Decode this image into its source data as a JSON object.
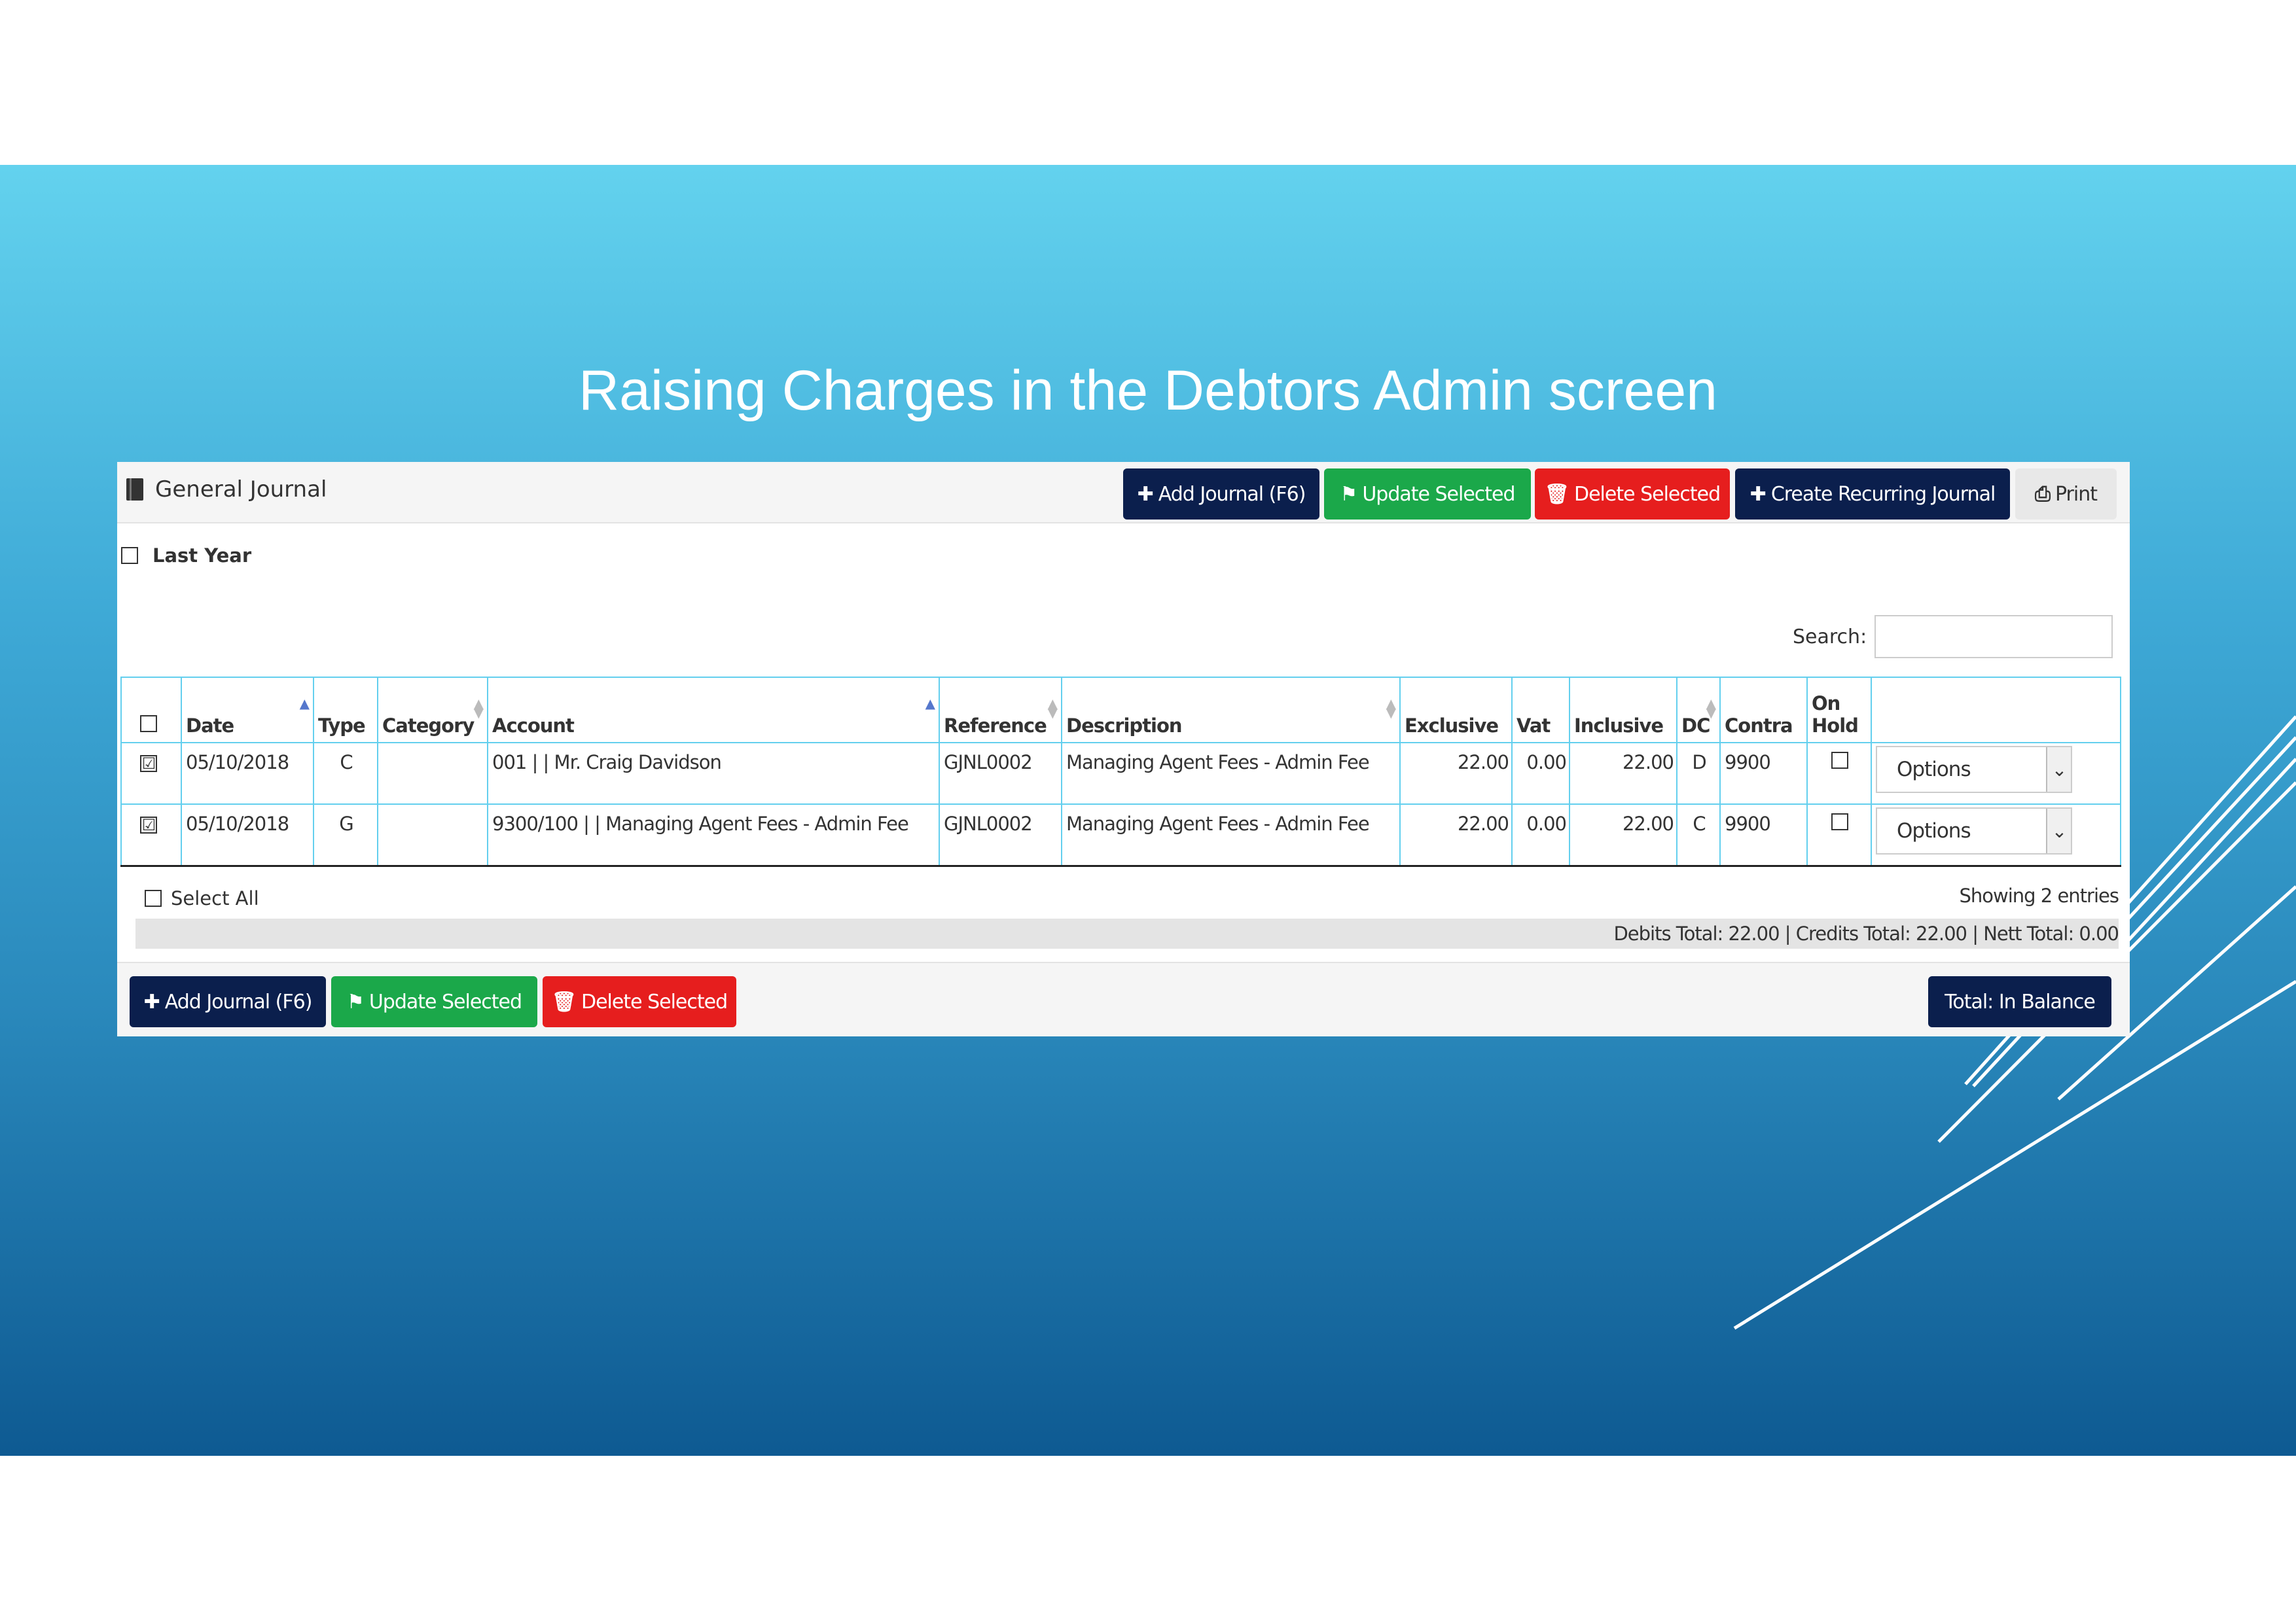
{
  "slide": {
    "title": "Raising Charges in the Debtors Admin screen"
  },
  "panel": {
    "title": "General Journal",
    "header_buttons": {
      "add": "Add Journal (F6)",
      "update": "Update Selected",
      "delete": "Delete Selected",
      "recurring": "Create Recurring Journal",
      "print": "Print"
    },
    "last_year_label": "Last Year",
    "search_label": "Search:",
    "search_value": ""
  },
  "table": {
    "columns": {
      "date": "Date",
      "type": "Type",
      "category": "Category",
      "account": "Account",
      "reference": "Reference",
      "description": "Description",
      "exclusive": "Exclusive",
      "vat": "Vat",
      "inclusive": "Inclusive",
      "dc": "DC",
      "contra": "Contra",
      "on_hold_1": "On",
      "on_hold_2": "Hold"
    },
    "rows": [
      {
        "checked": "☑",
        "date": "05/10/2018",
        "type": "C",
        "category": "",
        "account": "001 | | Mr. Craig Davidson",
        "reference": "GJNL0002",
        "description": "Managing Agent Fees - Admin Fee",
        "exclusive": "22.00",
        "vat": "0.00",
        "inclusive": "22.00",
        "dc": "D",
        "contra": "9900",
        "options": "Options"
      },
      {
        "checked": "☑",
        "date": "05/10/2018",
        "type": "G",
        "category": "",
        "account": "9300/100 | | Managing Agent Fees - Admin Fee",
        "reference": "GJNL0002",
        "description": "Managing Agent Fees - Admin Fee",
        "exclusive": "22.00",
        "vat": "0.00",
        "inclusive": "22.00",
        "dc": "C",
        "contra": "9900",
        "options": "Options"
      }
    ]
  },
  "footer": {
    "select_all": "Select All",
    "showing": "Showing 2 entries",
    "totals": "Debits Total: 22.00 | Credits Total: 22.00 | Nett Total: 0.00",
    "buttons": {
      "add": "Add Journal (F6)",
      "update": "Update Selected",
      "delete": "Delete Selected",
      "balance": "Total: In Balance"
    }
  },
  "colors": {
    "navy": "#0b1f4d",
    "green": "#1ba84a",
    "red": "#e61e1e",
    "grid_border": "#63cfee"
  }
}
